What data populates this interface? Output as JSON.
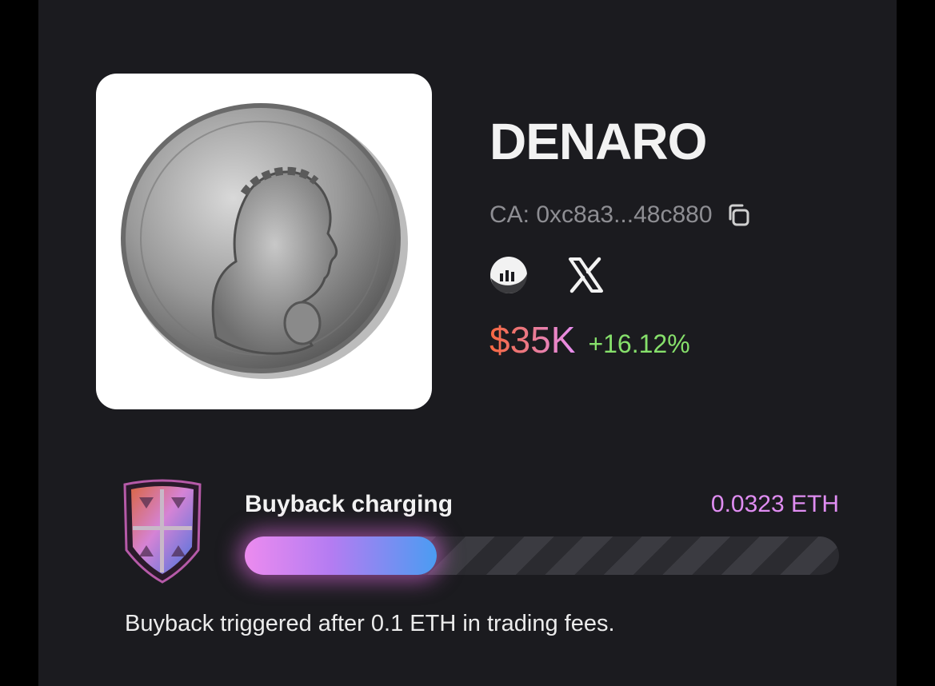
{
  "token": {
    "name": "DENARO",
    "contract": "CA: 0xc8a3...48c880",
    "price": "$35K",
    "change": "+16.12%"
  },
  "links": {
    "chart_icon": "chart-icon",
    "x_icon": "x-icon"
  },
  "buyback": {
    "label": "Buyback charging",
    "amount": "0.0323 ETH",
    "progress": 0.323,
    "note": "Buyback triggered after 0.1 ETH in trading fees."
  },
  "colors": {
    "background": "#1b1b1f",
    "accent_pink": "#e08df2",
    "positive": "#86e06b",
    "price_gradient_start": "#f7673f",
    "price_gradient_end": "#e98ff3"
  }
}
